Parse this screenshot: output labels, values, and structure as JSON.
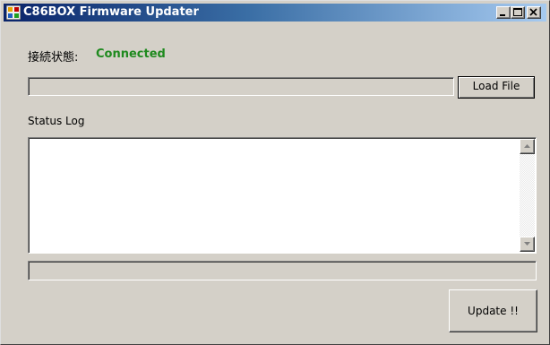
{
  "window": {
    "title": "C86BOX Firmware Updater",
    "icon": "app-icon"
  },
  "connection": {
    "label": "接続状態:",
    "value": "Connected",
    "value_color": "#1f8a1f"
  },
  "file": {
    "path_value": "",
    "load_button_label": "Load File"
  },
  "log": {
    "label": "Status Log",
    "content": ""
  },
  "progress": {
    "value": 0
  },
  "actions": {
    "update_button_label": "Update !!"
  }
}
